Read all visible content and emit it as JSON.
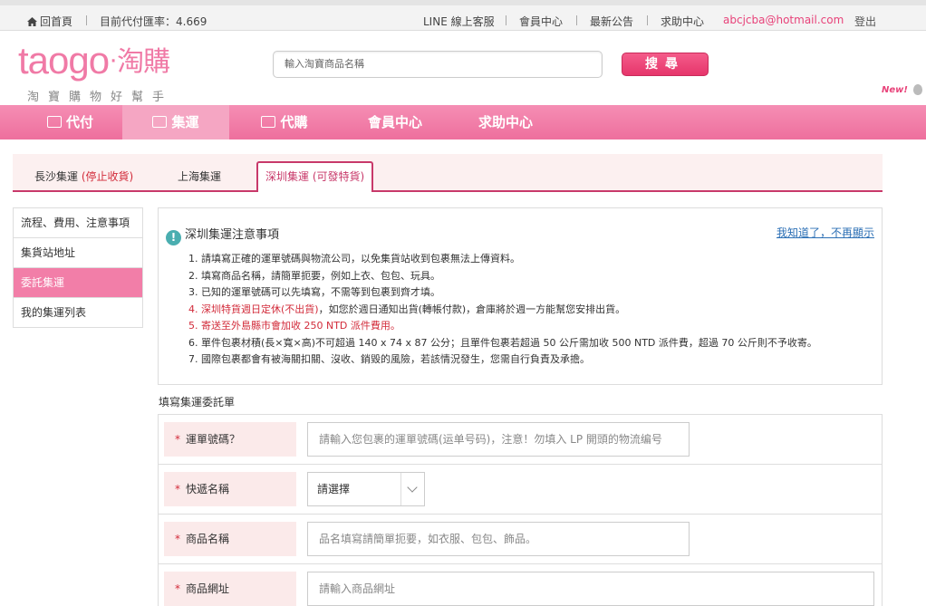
{
  "topbar": {
    "home": "回首頁",
    "rate": "目前代付匯率：4.669",
    "line_support": "LINE 線上客服",
    "member_center": "會員中心",
    "news": "最新公告",
    "help": "求助中心",
    "email": "abcjcba@hotmail.com",
    "logout": "登出"
  },
  "header": {
    "logo_en": "taogo",
    "logo_dot": "·",
    "logo_cn": "淘購",
    "logo_slogan": "淘寶購物好幫手",
    "search_placeholder": "輸入淘寶商品名稱",
    "search_button": "搜尋",
    "new_badge": "New!"
  },
  "nav": {
    "items": [
      {
        "label": "代付",
        "icon": "card-icon"
      },
      {
        "label": "集運",
        "icon": "box-icon"
      },
      {
        "label": "代購",
        "icon": "cart-icon"
      },
      {
        "label": "會員中心"
      },
      {
        "label": "求助中心"
      }
    ],
    "active_index": 1
  },
  "tabs": [
    {
      "label": "長沙集運",
      "note": "(停止收貨)"
    },
    {
      "label": "上海集運",
      "note": ""
    },
    {
      "label": "深圳集運",
      "note": "(可發特貨)"
    }
  ],
  "sidebar": {
    "items": [
      "流程、費用、注意事項",
      "集貨站地址",
      "委託集運",
      "我的集運列表"
    ],
    "active_index": 2
  },
  "notice": {
    "title": "深圳集運注意事項",
    "info_icon": "!",
    "dismiss": "我知道了，不再顯示",
    "items": [
      "1. 請填寫正確的運單號碼與物流公司，以免集貨站收到包裹無法上傳資料。",
      "2. 填寫商品名稱，請簡單扼要，例如上衣、包包、玩具。",
      "3. 已知的運單號碼可以先填寫，不需等到包裹到齊才填。",
      "5. 寄送至外島縣市會加收 250 NTD 派件費用。",
      "6. 單件包裹材積(長×寬×高)不可超過 140 x 74 x 87 公分；且單件包裹若超過 50 公斤需加收 500 NTD 派件費，超過 70 公斤則不予收寄。",
      "7. 國際包裹都會有被海關扣關、沒收、銷毀的風險，若該情況發生，您需自行負責及承擔。"
    ],
    "item4_red": "4. 深圳特貨週日定休(不出貨)",
    "item4_rest": "，如您於週日通知出貨(轉帳付款)，倉庫將於週一方能幫您安排出貨。"
  },
  "form": {
    "title": "填寫集運委託單",
    "required_mark": "*",
    "tracking_label": "運單號碼？",
    "tracking_placeholder": "請輸入您包裹的運單號碼(运单号码)，注意！勿填入 LP 開頭的物流编号",
    "courier_label": "快遞名稱",
    "courier_value": "請選擇",
    "product_label": "商品名稱",
    "product_placeholder": "品名填寫請簡單扼要，如衣服、包包、飾品。",
    "url_label": "商品網址",
    "url_placeholder": "請輸入商品網址"
  }
}
